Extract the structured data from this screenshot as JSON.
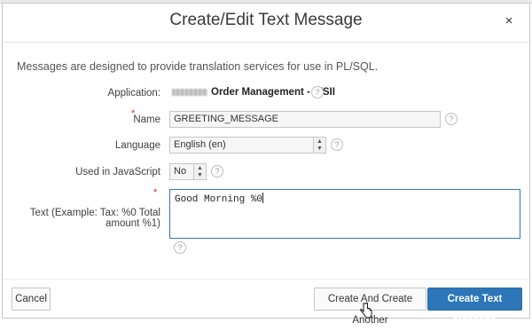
{
  "dialog": {
    "title": "Create/Edit Text Message",
    "close_icon": "×",
    "intro": "Messages are designed to provide translation services for use in PL/SQL."
  },
  "form": {
    "application": {
      "label": "Application:",
      "value": "Order Management - WSII"
    },
    "name": {
      "label": "Name",
      "required_mark": "*",
      "value": "GREETING_MESSAGE"
    },
    "language": {
      "label": "Language",
      "selected": "English (en)"
    },
    "used_in_javascript": {
      "label": "Used in JavaScript",
      "selected": "No"
    },
    "text": {
      "label": "Text (Example: Tax: %0 Total amount %1)",
      "required_mark": "*",
      "value": "Good Morning %0"
    },
    "help_icon": "?"
  },
  "buttons": {
    "cancel": "Cancel",
    "create_another": "Create And Create Another",
    "create": "Create Text Message"
  },
  "colors": {
    "primary": "#2d76b8",
    "required": "#e0261c",
    "focus": "#2f7ac0"
  }
}
